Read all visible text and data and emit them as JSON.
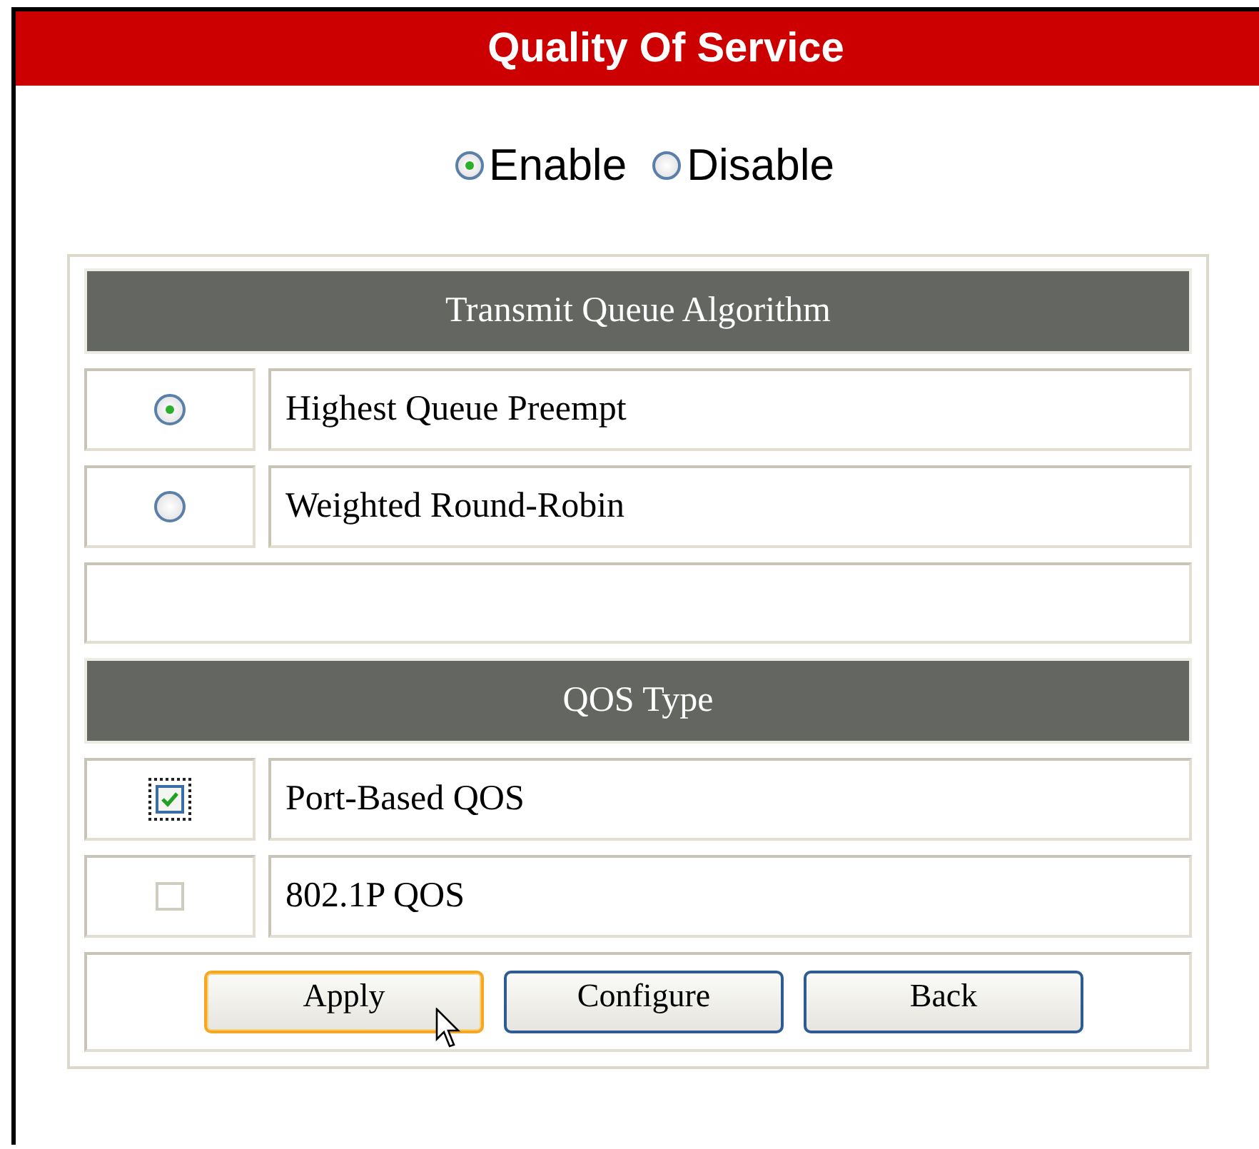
{
  "window": {
    "title": "Quality Of Service"
  },
  "mode": [
    {
      "label": "Enable",
      "selected": true
    },
    {
      "label": "Disable",
      "selected": false
    }
  ],
  "sections": [
    {
      "heading": "Transmit Queue Algorithm",
      "kind": "radio",
      "options": [
        {
          "label": "Highest Queue Preempt",
          "selected": true
        },
        {
          "label": "Weighted Round-Robin",
          "selected": false
        }
      ],
      "blank_row": true
    },
    {
      "heading": "QOS Type",
      "kind": "checkbox",
      "options": [
        {
          "label": "Port-Based QOS",
          "checked": true,
          "focused": true,
          "disabled": false
        },
        {
          "label": "802.1P QOS",
          "checked": false,
          "focused": false,
          "disabled": true
        }
      ]
    }
  ],
  "buttons": [
    {
      "label": "Apply",
      "hovered": true
    },
    {
      "label": "Configure",
      "hovered": false
    },
    {
      "label": "Back",
      "hovered": false
    }
  ]
}
